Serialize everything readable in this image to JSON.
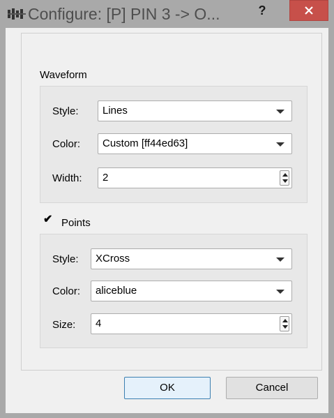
{
  "window": {
    "title": "Configure: [P] PIN 3 -> O...",
    "help_label": "?",
    "close_label": "✕"
  },
  "waveform": {
    "group_label": "Waveform",
    "style_label": "Style:",
    "style_value": "Lines",
    "color_label": "Color:",
    "color_value": "Custom [ff44ed63]",
    "width_label": "Width:",
    "width_value": "2"
  },
  "points": {
    "checkbox_mark": "✔",
    "checked": true,
    "group_label": "Points",
    "style_label": "Style:",
    "style_value": "XCross",
    "color_label": "Color:",
    "color_value": "aliceblue",
    "size_label": "Size:",
    "size_value": "4"
  },
  "buttons": {
    "ok_label": "OK",
    "cancel_label": "Cancel"
  }
}
